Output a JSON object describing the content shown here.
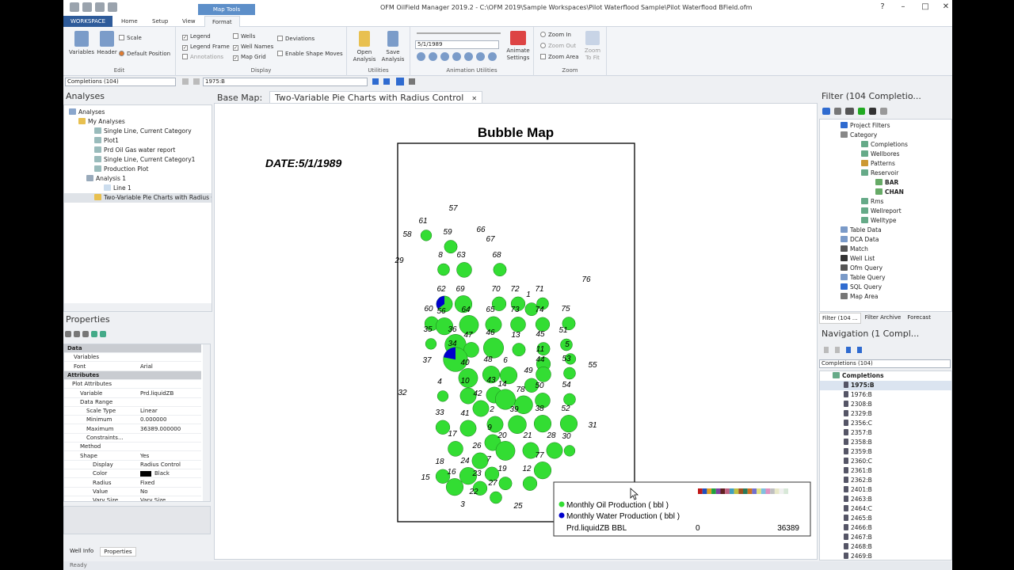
{
  "title": "OFM OilField Manager 2019.2 - C:\\OFM 2019\\Sample Workspaces\\Pilot Waterflood Sample\\Pilot Waterflood BField.ofm",
  "ribbon_context": "Map Tools",
  "tabs": [
    "WORKSPACE",
    "Home",
    "Setup",
    "View",
    "Format"
  ],
  "edit": {
    "variables": "Variables",
    "header": "Header",
    "scale": "Scale",
    "default_position": "Default Position",
    "label": "Edit"
  },
  "display": {
    "legend": "Legend",
    "legend_frame": "Legend Frame",
    "annotations": "Annotations",
    "wells": "Wells",
    "well_names": "Well Names",
    "map_grid": "Map Grid",
    "deviations": "Deviations",
    "enable_shape_moves": "Enable Shape Moves",
    "label": "Display"
  },
  "utilities": {
    "open": "Open",
    "open2": "Analysis",
    "save": "Save",
    "save2": "Analysis",
    "label": "Utilities"
  },
  "animation": {
    "date": "5/1/1989",
    "animate": "Animate",
    "settings": "Settings",
    "label": "Animation Utilities"
  },
  "zoom": {
    "zoom_in": "Zoom In",
    "zoom_out": "Zoom Out",
    "zoom_area": "Zoom Area",
    "zoom_to": "Zoom",
    "fit": "To Fit",
    "label": "Zoom"
  },
  "cmdbar": {
    "selector": "Completions (104)",
    "well": "1975:B"
  },
  "analyses": {
    "title": "Analyses",
    "items": [
      "Analyses",
      "My Analyses",
      "Single Line, Current Category",
      "Plot1",
      "Prd Oil Gas water report",
      "Single Line, Current Category1",
      "Production Plot",
      "Analysis 1",
      "Line 1",
      "Two-Variable Pie Charts with Radius C"
    ]
  },
  "properties": {
    "title": "Properties",
    "rows": [
      {
        "k": "Data",
        "v": ""
      },
      {
        "k": "Variables",
        "v": ""
      },
      {
        "k": "Font",
        "v": "Arial"
      },
      {
        "k": "Attributes",
        "v": ""
      },
      {
        "k": "Plot Attributes",
        "v": ""
      },
      {
        "k": "Variable",
        "v": "Prd.liquidZB"
      },
      {
        "k": "Data Range",
        "v": ""
      },
      {
        "k": "Scale Type",
        "v": "Linear"
      },
      {
        "k": "Minimum",
        "v": "0.000000"
      },
      {
        "k": "Maximum",
        "v": "36389.000000"
      },
      {
        "k": "Constraints...",
        "v": ""
      },
      {
        "k": "Method",
        "v": ""
      },
      {
        "k": "Shape",
        "v": "Yes"
      },
      {
        "k": "Display",
        "v": "Radius Control"
      },
      {
        "k": "Color",
        "v": "Black"
      },
      {
        "k": "Radius",
        "v": "Fixed"
      },
      {
        "k": "Value",
        "v": "No"
      },
      {
        "k": "Vary Size",
        "v": "Vary Size"
      }
    ],
    "bottom_tabs": [
      "Well Info",
      "Properties"
    ]
  },
  "document": {
    "base_label": "Base Map:",
    "tab": "Two-Variable Pie Charts with Radius Control",
    "map_title": "Bubble Map",
    "date": "DATE:5/1/1989"
  },
  "legend": {
    "oil": "Monthly Oil Production ( bbl )",
    "water": "Monthly Water Production ( bbl )",
    "var": "Prd.liquidZB BBL",
    "min": "0",
    "max": "36389",
    "oil_color": "#33dd33",
    "water_color": "#0000cc"
  },
  "wells": [
    {
      "n": "57",
      "b": 0
    },
    {
      "n": "61",
      "b": 0.3
    },
    {
      "n": "58",
      "b": 0
    },
    {
      "n": "59",
      "b": 0.4
    },
    {
      "n": "66",
      "b": 0
    },
    {
      "n": "67",
      "b": 0
    },
    {
      "n": "8",
      "b": 0.35
    },
    {
      "n": "63",
      "b": 0.5
    },
    {
      "n": "68",
      "b": 0.4
    },
    {
      "n": "29",
      "b": 0
    },
    {
      "n": "62",
      "b": 0.55
    },
    {
      "n": "69",
      "b": 0.6
    },
    {
      "n": "70",
      "b": 0.45
    },
    {
      "n": "72",
      "b": 0.45
    },
    {
      "n": "71",
      "b": 0.35
    },
    {
      "n": "76",
      "b": 0
    },
    {
      "n": "1",
      "b": 0.4
    },
    {
      "n": "60",
      "b": 0.45
    },
    {
      "n": "56",
      "b": 0.6
    },
    {
      "n": "64",
      "b": 0.7
    },
    {
      "n": "65",
      "b": 0.55
    },
    {
      "n": "73",
      "b": 0.5
    },
    {
      "n": "74",
      "b": 0.45
    },
    {
      "n": "75",
      "b": 0.4
    },
    {
      "n": "35",
      "b": 0.3
    },
    {
      "n": "36",
      "b": 0.8
    },
    {
      "n": "47",
      "b": 0.5
    },
    {
      "n": "46",
      "b": 0.75
    },
    {
      "n": "13",
      "b": 0.4
    },
    {
      "n": "45",
      "b": 0.4
    },
    {
      "n": "51",
      "b": 0.35
    },
    {
      "n": "5",
      "b": 0.3
    },
    {
      "n": "34",
      "b": 0.95
    },
    {
      "n": "11",
      "b": 0.45
    },
    {
      "n": "37",
      "b": 0
    },
    {
      "n": "40",
      "b": 0.7
    },
    {
      "n": "48",
      "b": 0.6
    },
    {
      "n": "6",
      "b": 0.6
    },
    {
      "n": "44",
      "b": 0.5
    },
    {
      "n": "53",
      "b": 0.35
    },
    {
      "n": "55",
      "b": 0
    },
    {
      "n": "49",
      "b": 0.45
    },
    {
      "n": "4",
      "b": 0.3
    },
    {
      "n": "10",
      "b": 0.55
    },
    {
      "n": "43",
      "b": 0.55
    },
    {
      "n": "14",
      "b": 0.75
    },
    {
      "n": "78",
      "b": 0.65
    },
    {
      "n": "50",
      "b": 0.5
    },
    {
      "n": "54",
      "b": 0.35
    },
    {
      "n": "32",
      "b": 0
    },
    {
      "n": "42",
      "b": 0.55
    },
    {
      "n": "33",
      "b": 0.45
    },
    {
      "n": "41",
      "b": 0.55
    },
    {
      "n": "2",
      "b": 0.55
    },
    {
      "n": "39",
      "b": 0.65
    },
    {
      "n": "38",
      "b": 0.6
    },
    {
      "n": "52",
      "b": 0.6
    },
    {
      "n": "31",
      "b": 0
    },
    {
      "n": "17",
      "b": 0.5
    },
    {
      "n": "9",
      "b": 0.55
    },
    {
      "n": "20",
      "b": 0.7
    },
    {
      "n": "21",
      "b": 0.55
    },
    {
      "n": "28",
      "b": 0.55
    },
    {
      "n": "30",
      "b": 0.3
    },
    {
      "n": "26",
      "b": 0.55
    },
    {
      "n": "18",
      "b": 0.45
    },
    {
      "n": "24",
      "b": 0.6
    },
    {
      "n": "7",
      "b": 0.45
    },
    {
      "n": "77",
      "b": 0.6
    },
    {
      "n": "16",
      "b": 0.6
    },
    {
      "n": "23",
      "b": 0.45
    },
    {
      "n": "19",
      "b": 0.4
    },
    {
      "n": "12",
      "b": 0.45
    },
    {
      "n": "15",
      "b": 0
    },
    {
      "n": "27",
      "b": 0.35
    },
    {
      "n": "22",
      "b": 0
    },
    {
      "n": "3",
      "b": 0
    },
    {
      "n": "25",
      "b": 0
    }
  ],
  "filter": {
    "title": "Filter (104 Completio...",
    "items": [
      "Project Filters",
      "Category",
      "Completions",
      "Wellbores",
      "Patterns",
      "Reservoir",
      "BAR",
      "CHAN",
      "Rms",
      "Wellreport",
      "Welltype",
      "Table Data",
      "DCA Data",
      "Match",
      "Well List",
      "Ofm Query",
      "Table Query",
      "SQL Query",
      "Map Area"
    ],
    "tabs": [
      "Filter (104 ...",
      "Filter Archive",
      "Forecast"
    ]
  },
  "navigation": {
    "title": "Navigation (1 Compl...",
    "selector": "Completions (104)",
    "root": "Completions",
    "items": [
      "1975:B",
      "1976:B",
      "2308:B",
      "2329:B",
      "2356:C",
      "2357:B",
      "2358:B",
      "2359:B",
      "2360:C",
      "2361:B",
      "2362:B",
      "2401:B",
      "2463:B",
      "2464:C",
      "2465:B",
      "2466:B",
      "2467:B",
      "2468:B",
      "2469:B"
    ]
  },
  "status": "Ready"
}
